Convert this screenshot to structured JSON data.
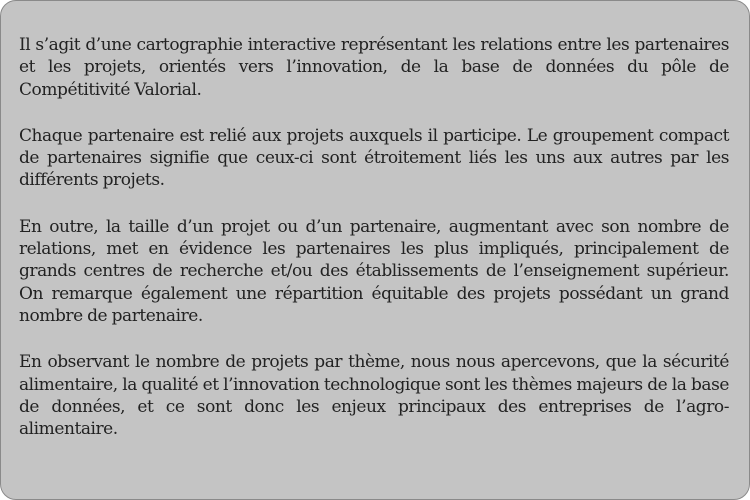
{
  "paragraphs": [
    "Il s’agit d’une cartographie interactive représentant les relations entre les partenaires et les projets, orientés vers l’innovation, de la base de données du pôle de Compétitivité Valorial.",
    "Chaque partenaire est relié aux projets auxquels il participe. Le groupement compact de partenaires signifie que ceux-ci sont étroitement liés les uns aux autres par les différents projets.",
    "En outre, la taille d’un projet ou d’un partenaire, augmentant avec son nombre de relations, met en évidence les partenaires les plus impliqués, principalement de grands centres de recherche et/ou des établissements de l’enseignement supérieur. On remarque également une répartition équitable des projets possédant un grand nombre de partenaire.",
    "En observant le nombre de projets par thème, nous nous apercevons, que la sécurité alimentaire, la qualité et l’innovation technologique sont les thèmes majeurs de la base de données, et ce sont donc les enjeux principaux des entreprises de l’agro-alimentaire."
  ]
}
